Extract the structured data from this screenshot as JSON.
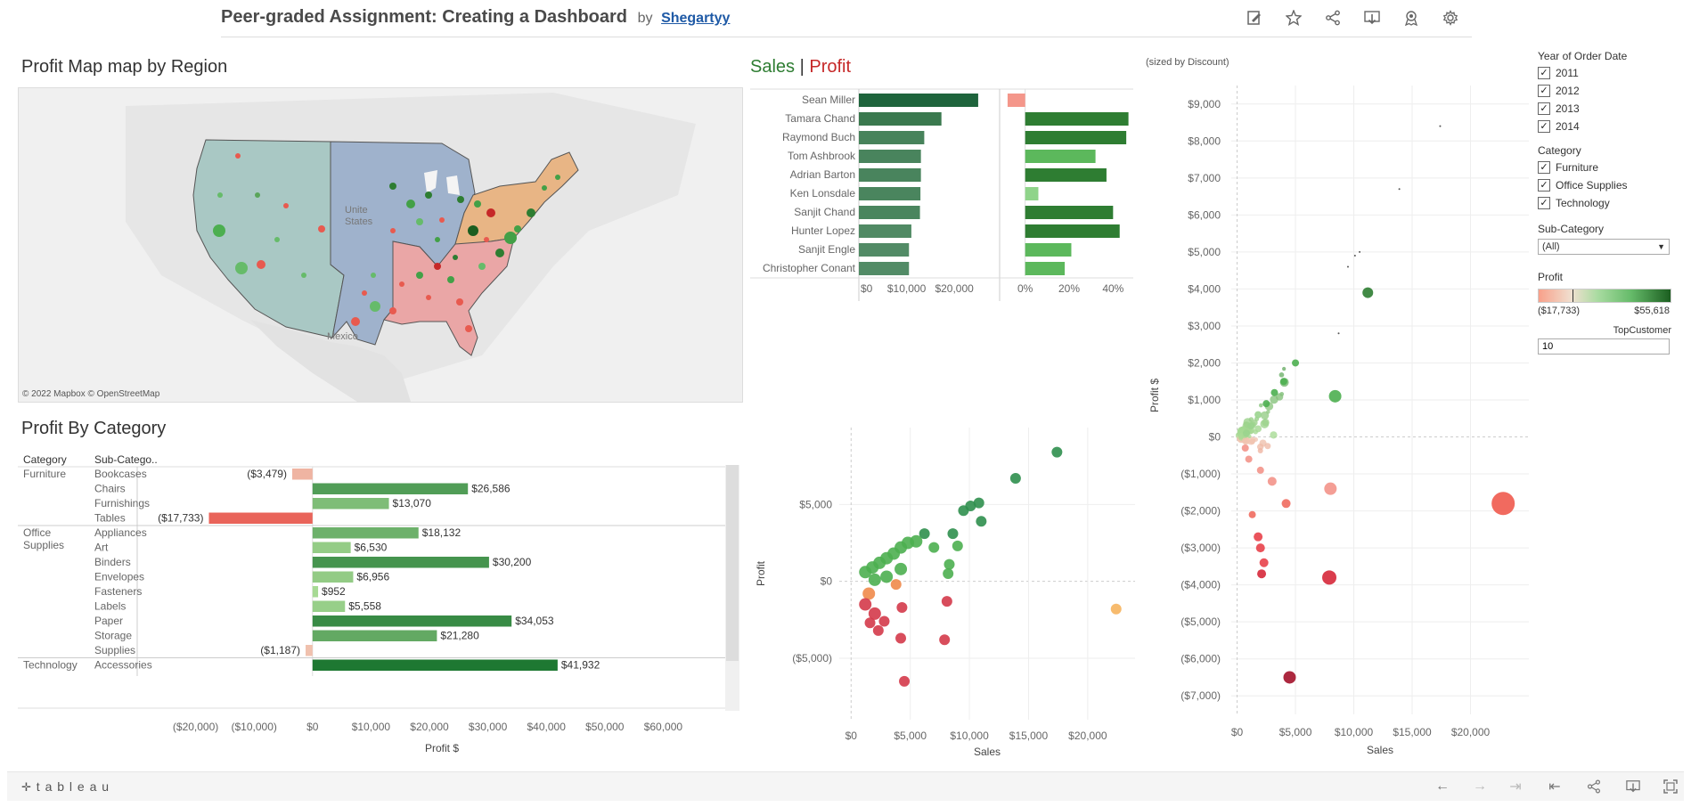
{
  "header": {
    "title": "Peer-graded Assignment: Creating a Dashboard",
    "by": "by",
    "author": "Shegartyy",
    "icons": [
      "edit-icon",
      "star-icon",
      "share-icon",
      "download-icon",
      "metrics-icon",
      "settings-icon"
    ]
  },
  "map": {
    "title": "Profit Map map by Region",
    "labels": {
      "us1": "Unite",
      "us2": "States",
      "mexico": "Mexico"
    },
    "attribution": "© 2022 Mapbox © OpenStreetMap"
  },
  "category_panel": {
    "title": "Profit By Category",
    "col_category": "Category",
    "col_subcategory": "Sub-Catego..",
    "axis_title": "Profit $"
  },
  "sales_profit": {
    "title_sales": "Sales",
    "title_sep": "|",
    "title_profit": "Profit"
  },
  "scatter_right": {
    "note": "(sized by Discount)",
    "ylabel": "Profit $",
    "xlabel": "Sales"
  },
  "scatter_mid": {
    "ylabel": "Profit",
    "xlabel": "Sales"
  },
  "filters": {
    "year_title": "Year of Order Date",
    "years": [
      "2011",
      "2012",
      "2013",
      "2014"
    ],
    "category_title": "Category",
    "categories": [
      "Furniture",
      "Office Supplies",
      "Technology"
    ],
    "check": "✓",
    "subcat_title": "Sub-Category",
    "subcat_value": "(All)",
    "profit_title": "Profit",
    "profit_min": "($17,733)",
    "profit_max": "$55,618",
    "topcustomer_title": "TopCustomer",
    "topcustomer_value": "10"
  },
  "footer": {
    "logo": "t a b l e a u"
  },
  "chart_data": [
    {
      "type": "bar",
      "title": "Profit By Category",
      "xlabel": "Profit $",
      "xlim": [
        -30000,
        70000
      ],
      "ticks": [
        "($20,000)",
        "($10,000)",
        "$0",
        "$10,000",
        "$20,000",
        "$30,000",
        "$40,000",
        "$50,000",
        "$60,000"
      ],
      "tick_values": [
        -20000,
        -10000,
        0,
        10000,
        20000,
        30000,
        40000,
        50000,
        60000
      ],
      "groups": [
        {
          "category": "Furniture",
          "rows": [
            {
              "sub": "Bookcases",
              "value": -3479,
              "label": "($3,479)"
            },
            {
              "sub": "Chairs",
              "value": 26586,
              "label": "$26,586"
            },
            {
              "sub": "Furnishings",
              "value": 13070,
              "label": "$13,070"
            },
            {
              "sub": "Tables",
              "value": -17733,
              "label": "($17,733)"
            }
          ]
        },
        {
          "category": "Office Supplies",
          "rows": [
            {
              "sub": "Appliances",
              "value": 18132,
              "label": "$18,132"
            },
            {
              "sub": "Art",
              "value": 6530,
              "label": "$6,530"
            },
            {
              "sub": "Binders",
              "value": 30200,
              "label": "$30,200"
            },
            {
              "sub": "Envelopes",
              "value": 6956,
              "label": "$6,956"
            },
            {
              "sub": "Fasteners",
              "value": 952,
              "label": "$952"
            },
            {
              "sub": "Labels",
              "value": 5558,
              "label": "$5,558"
            },
            {
              "sub": "Paper",
              "value": 34053,
              "label": "$34,053"
            },
            {
              "sub": "Storage",
              "value": 21280,
              "label": "$21,280"
            },
            {
              "sub": "Supplies",
              "value": -1187,
              "label": "($1,187)"
            }
          ]
        },
        {
          "category": "Technology",
          "rows": [
            {
              "sub": "Accessories",
              "value": 41932,
              "label": "$41,932"
            }
          ]
        }
      ]
    },
    {
      "type": "bar",
      "title": "Sales | Profit",
      "categories": [
        "Sean Miller",
        "Tamara Chand",
        "Raymond Buch",
        "Tom Ashbrook",
        "Adrian Barton",
        "Ken Lonsdale",
        "Sanjit Chand",
        "Hunter Lopez",
        "Sanjit Engle",
        "Christopher Conant"
      ],
      "series": [
        {
          "name": "Sales",
          "values": [
            25000,
            17300,
            13700,
            13000,
            13000,
            12900,
            12800,
            11000,
            10500,
            10500
          ],
          "ticks": [
            "$0",
            "$10,000",
            "$20,000"
          ],
          "tick_values": [
            0,
            10000,
            20000
          ],
          "xlim": [
            0,
            28000
          ]
        },
        {
          "name": "Profit",
          "values": [
            -0.08,
            0.47,
            0.46,
            0.32,
            0.37,
            0.06,
            0.4,
            0.43,
            0.21,
            0.18
          ],
          "ticks": [
            "0%",
            "20%",
            "40%"
          ],
          "tick_values": [
            0,
            0.2,
            0.4
          ],
          "xlim": [
            -0.1,
            0.5
          ]
        }
      ]
    },
    {
      "type": "scatter",
      "xlabel": "Sales",
      "ylabel": "Profit",
      "xlim": [
        -1000,
        24000
      ],
      "ylim": [
        -9000,
        10000
      ],
      "xticks": [
        "$0",
        "$5,000",
        "$10,000",
        "$15,000",
        "$20,000"
      ],
      "xtick_values": [
        0,
        5000,
        10000,
        15000,
        20000
      ],
      "yticks": [
        "($5,000)",
        "$0",
        "$5,000"
      ],
      "ytick_values": [
        -5000,
        0,
        5000
      ],
      "points": [
        {
          "x": 17400,
          "y": 8400,
          "r": 6
        },
        {
          "x": 13900,
          "y": 6700,
          "r": 6
        },
        {
          "x": 10800,
          "y": 5100,
          "r": 6
        },
        {
          "x": 10100,
          "y": 4900,
          "r": 6
        },
        {
          "x": 9500,
          "y": 4600,
          "r": 6
        },
        {
          "x": 11000,
          "y": 3900,
          "r": 6
        },
        {
          "x": 8600,
          "y": 3100,
          "r": 6
        },
        {
          "x": 9000,
          "y": 2300,
          "r": 6
        },
        {
          "x": 6200,
          "y": 3100,
          "r": 6
        },
        {
          "x": 5500,
          "y": 2600,
          "r": 7
        },
        {
          "x": 4800,
          "y": 2500,
          "r": 7
        },
        {
          "x": 4200,
          "y": 2200,
          "r": 7
        },
        {
          "x": 3600,
          "y": 1800,
          "r": 7
        },
        {
          "x": 3000,
          "y": 1500,
          "r": 7
        },
        {
          "x": 2400,
          "y": 1200,
          "r": 7
        },
        {
          "x": 1800,
          "y": 900,
          "r": 7
        },
        {
          "x": 1200,
          "y": 600,
          "r": 7
        },
        {
          "x": 7000,
          "y": 2200,
          "r": 6
        },
        {
          "x": 8300,
          "y": 1100,
          "r": 6
        },
        {
          "x": 8200,
          "y": 500,
          "r": 6
        },
        {
          "x": 4200,
          "y": 800,
          "r": 7
        },
        {
          "x": 3000,
          "y": 300,
          "r": 7
        },
        {
          "x": 2000,
          "y": 100,
          "r": 7
        },
        {
          "x": 3800,
          "y": -200,
          "r": 6
        },
        {
          "x": 22400,
          "y": -1800,
          "r": 6
        },
        {
          "x": 8100,
          "y": -1300,
          "r": 6
        },
        {
          "x": 1500,
          "y": -800,
          "r": 7
        },
        {
          "x": 1200,
          "y": -1500,
          "r": 7
        },
        {
          "x": 2000,
          "y": -2100,
          "r": 7
        },
        {
          "x": 2800,
          "y": -2600,
          "r": 6
        },
        {
          "x": 4300,
          "y": -1700,
          "r": 6
        },
        {
          "x": 4200,
          "y": -3700,
          "r": 6
        },
        {
          "x": 7900,
          "y": -3800,
          "r": 6
        },
        {
          "x": 4500,
          "y": -6500,
          "r": 6
        },
        {
          "x": 2300,
          "y": -3200,
          "r": 6
        },
        {
          "x": 1600,
          "y": -2700,
          "r": 6
        }
      ]
    },
    {
      "type": "scatter",
      "note": "(sized by Discount)",
      "xlabel": "Sales",
      "ylabel": "Profit $",
      "xlim": [
        -500,
        25000
      ],
      "ylim": [
        -7500,
        9500
      ],
      "xticks": [
        "$0",
        "$5,000",
        "$10,000",
        "$15,000",
        "$20,000"
      ],
      "xtick_values": [
        0,
        5000,
        10000,
        15000,
        20000
      ],
      "yticks": [
        "$9,000",
        "$8,000",
        "$7,000",
        "$6,000",
        "$5,000",
        "$4,000",
        "$3,000",
        "$2,000",
        "$1,000",
        "$0",
        "($1,000)",
        "($2,000)",
        "($3,000)",
        "($4,000)",
        "($5,000)",
        "($6,000)",
        "($7,000)"
      ],
      "ytick_values": [
        9000,
        8000,
        7000,
        6000,
        5000,
        4000,
        3000,
        2000,
        1000,
        0,
        -1000,
        -2000,
        -3000,
        -4000,
        -5000,
        -6000,
        -7000
      ],
      "points": [
        {
          "x": 17400,
          "y": 8400,
          "r": 1
        },
        {
          "x": 13900,
          "y": 6700,
          "r": 1
        },
        {
          "x": 10500,
          "y": 5000,
          "r": 1
        },
        {
          "x": 10100,
          "y": 4900,
          "r": 1
        },
        {
          "x": 9500,
          "y": 4600,
          "r": 1
        },
        {
          "x": 11200,
          "y": 3900,
          "r": 6
        },
        {
          "x": 8700,
          "y": 2800,
          "r": 1
        },
        {
          "x": 8400,
          "y": 1100,
          "r": 7
        },
        {
          "x": 5000,
          "y": 2000,
          "r": 4
        },
        {
          "x": 4000,
          "y": 1500,
          "r": 4
        },
        {
          "x": 3200,
          "y": 1200,
          "r": 4
        },
        {
          "x": 2500,
          "y": 900,
          "r": 4
        },
        {
          "x": 1800,
          "y": 600,
          "r": 4
        },
        {
          "x": 1200,
          "y": 300,
          "r": 4
        },
        {
          "x": 800,
          "y": 100,
          "r": 4
        },
        {
          "x": 700,
          "y": -300,
          "r": 4
        },
        {
          "x": 1000,
          "y": -600,
          "r": 4
        },
        {
          "x": 2000,
          "y": -900,
          "r": 4
        },
        {
          "x": 3000,
          "y": -1200,
          "r": 5
        },
        {
          "x": 4200,
          "y": -1800,
          "r": 5
        },
        {
          "x": 8000,
          "y": -1400,
          "r": 7
        },
        {
          "x": 22800,
          "y": -1800,
          "r": 13
        },
        {
          "x": 1300,
          "y": -2100,
          "r": 4
        },
        {
          "x": 1800,
          "y": -2700,
          "r": 5
        },
        {
          "x": 2000,
          "y": -3000,
          "r": 5
        },
        {
          "x": 2300,
          "y": -3400,
          "r": 5
        },
        {
          "x": 2100,
          "y": -3700,
          "r": 5
        },
        {
          "x": 7900,
          "y": -3800,
          "r": 8
        },
        {
          "x": 4500,
          "y": -6500,
          "r": 7
        }
      ]
    }
  ]
}
